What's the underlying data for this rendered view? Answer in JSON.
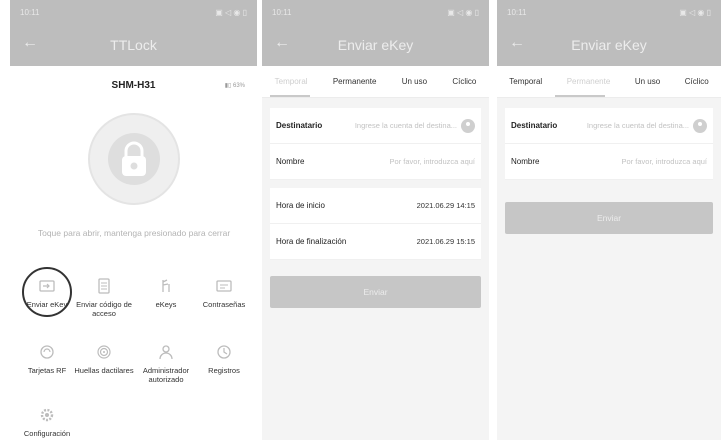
{
  "screen1": {
    "status_time": "10:11",
    "status_icons": "▣ ◁ ◉ ▯",
    "back_symbol": "←",
    "title": "TTLock",
    "lock_name": "SHM-H31",
    "battery": "▮▯ 63%",
    "hint": "Toque para abrir, mantenga presionado para cerrar",
    "grid": [
      {
        "label": "Enviar eKey",
        "icon": "send-ekey-icon"
      },
      {
        "label": "Enviar código de acceso",
        "icon": "passcode-icon"
      },
      {
        "label": "eKeys",
        "icon": "ekeys-icon"
      },
      {
        "label": "Contraseñas",
        "icon": "passwords-icon"
      },
      {
        "label": "Tarjetas RF",
        "icon": "rf-card-icon"
      },
      {
        "label": "Huellas dactilares",
        "icon": "fingerprint-icon"
      },
      {
        "label": "Administrador autorizado",
        "icon": "admin-icon"
      },
      {
        "label": "Registros",
        "icon": "records-icon"
      },
      {
        "label": "Configuración",
        "icon": "settings-icon"
      }
    ]
  },
  "screen2": {
    "status_time": "10:11",
    "status_icons": "▣ ◁ ◉ ▯",
    "back_symbol": "←",
    "title": "Enviar eKey",
    "tabs": [
      "Temporal",
      "Permanente",
      "Un uso",
      "Cíclico"
    ],
    "active_tab": "Temporal",
    "recipient_label": "Destinatario",
    "recipient_placeholder": "Ingrese la cuenta del destina...",
    "name_label": "Nombre",
    "name_placeholder": "Por favor, introduzca aquí",
    "start_label": "Hora de inicio",
    "start_value": "2021.06.29 14:15",
    "end_label": "Hora de finalización",
    "end_value": "2021.06.29 15:15",
    "send_label": "Enviar"
  },
  "screen3": {
    "status_time": "10:11",
    "status_icons": "▣ ◁ ◉ ▯",
    "back_symbol": "←",
    "title": "Enviar eKey",
    "tabs": [
      "Temporal",
      "Permanente",
      "Un uso",
      "Cíclico"
    ],
    "active_tab": "Permanente",
    "recipient_label": "Destinatario",
    "recipient_placeholder": "Ingrese la cuenta del destina...",
    "name_label": "Nombre",
    "name_placeholder": "Por favor, introduzca aquí",
    "send_label": "Enviar"
  },
  "colors": {
    "header": "#bdbdbd",
    "button": "#c6c6c6",
    "background": "#f4f4f4",
    "active_tab": "#cfcfcf"
  }
}
